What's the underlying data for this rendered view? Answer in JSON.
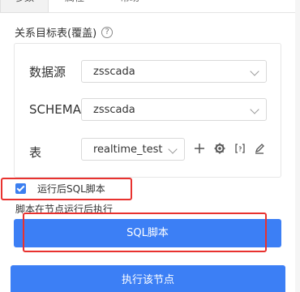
{
  "tabs": [
    {
      "label": "参数"
    },
    {
      "label": "属性"
    },
    {
      "label": "帮助"
    }
  ],
  "section": {
    "title": "关系目标表(覆盖)",
    "help_glyph": "?"
  },
  "form": {
    "datasource_label": "数据源",
    "datasource_value": "zsscada",
    "schema_label": "SCHEMA",
    "schema_value": "zsscada",
    "table_label": "表",
    "table_value": "realtime_test"
  },
  "icons": {
    "add": "plus-icon",
    "settings": "gear-icon",
    "bracket": "bracket-icon",
    "edit": "pencil-icon"
  },
  "options": {
    "run_after_sql_label": "运行后SQL脚本",
    "run_after_sql_checked": true,
    "description": "脚本在节点运行后执行"
  },
  "buttons": {
    "sql_script": "SQL脚本",
    "execute_node": "执行该节点"
  },
  "colors": {
    "primary": "#3c7ff5",
    "highlight_red": "#e8322f"
  }
}
